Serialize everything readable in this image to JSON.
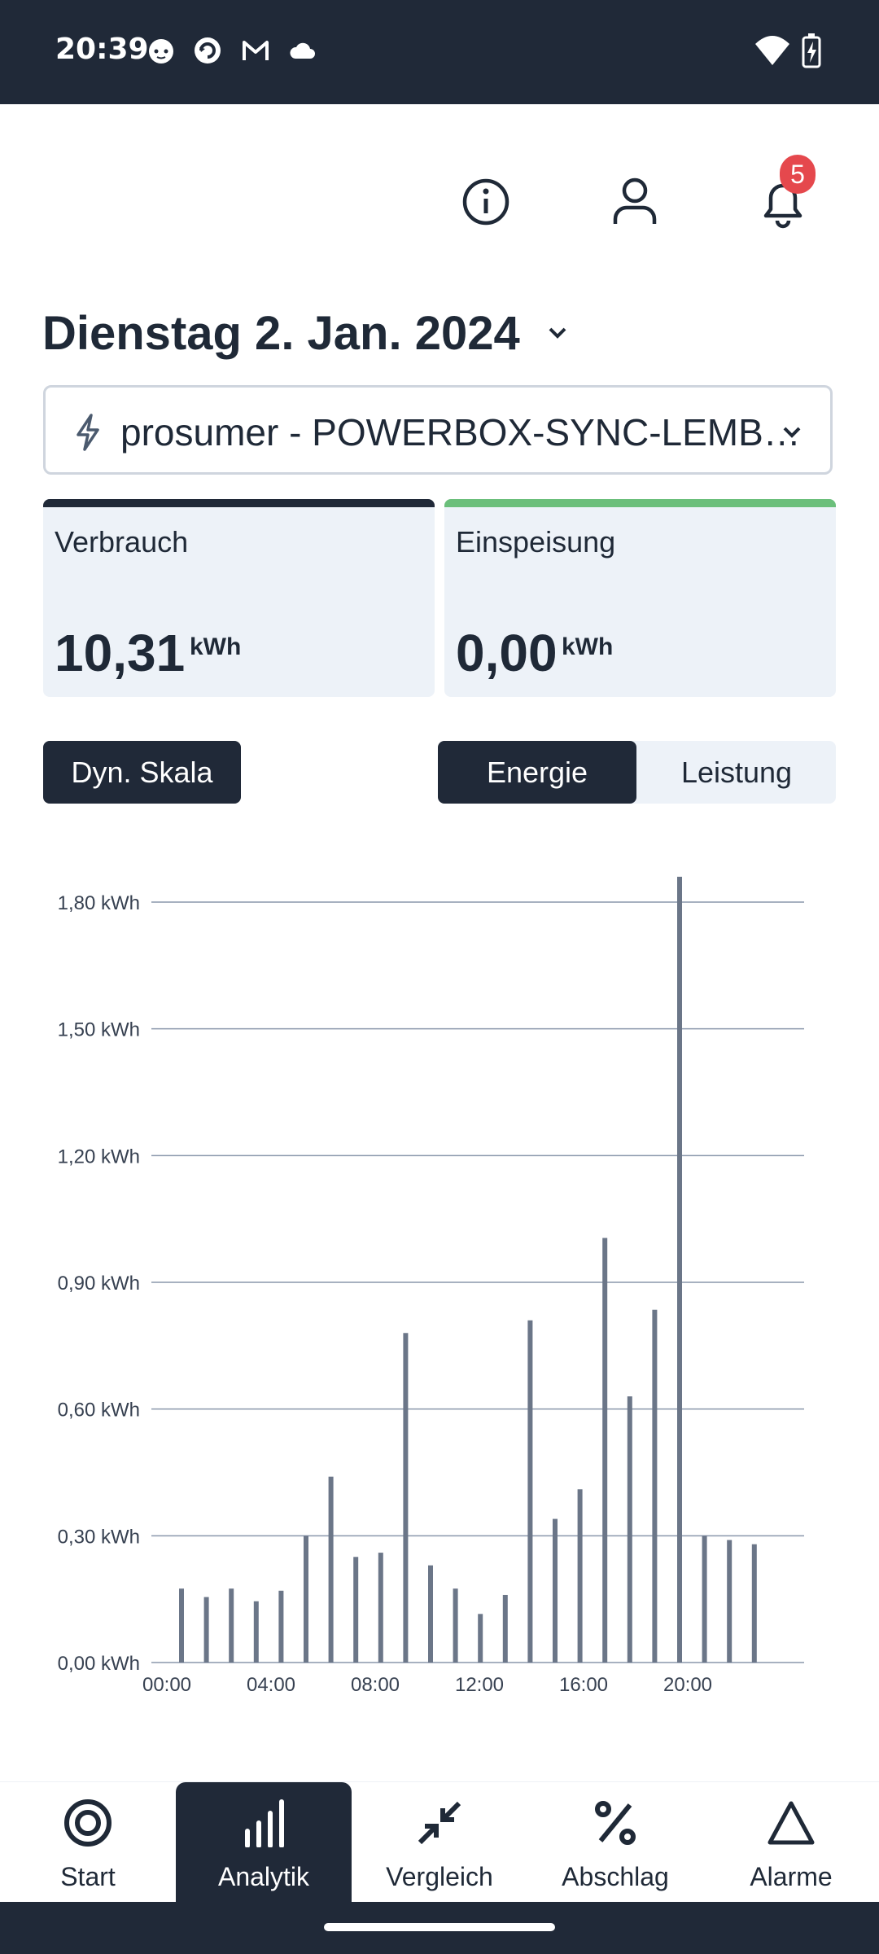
{
  "status_bar": {
    "time": "20:39"
  },
  "header": {
    "notification_count": "5"
  },
  "date": {
    "label": "Dienstag 2. Jan. 2024"
  },
  "meter_select": {
    "value": "prosumer - POWERBOX-SYNC-LEMB…"
  },
  "cards": {
    "consumption": {
      "label": "Verbrauch",
      "value": "10,31",
      "unit": "kWh",
      "color": "#202938"
    },
    "feed_in": {
      "label": "Einspeisung",
      "value": "0,00",
      "unit": "kWh",
      "color": "#6bbf7b"
    }
  },
  "controls": {
    "dyn_scale_label": "Dyn. Skala",
    "tabs": [
      {
        "label": "Energie",
        "active": true
      },
      {
        "label": "Leistung",
        "active": false
      }
    ]
  },
  "chart_data": {
    "type": "bar",
    "y_ticks": [
      "0,00 kWh",
      "0,30 kWh",
      "0,60 kWh",
      "0,90 kWh",
      "1,20 kWh",
      "1,50 kWh",
      "1,80 kWh"
    ],
    "x_ticks": [
      "00:00",
      "04:00",
      "08:00",
      "12:00",
      "16:00",
      "20:00"
    ],
    "ylim": [
      0,
      1.8
    ],
    "grid": true,
    "bar_color": "#6b7688",
    "x": [
      1,
      2,
      3,
      4,
      5,
      6,
      7,
      8,
      9,
      10,
      11,
      12,
      13,
      14,
      15,
      16,
      17,
      18,
      19,
      20,
      21,
      22,
      23,
      24
    ],
    "values": [
      0.175,
      0.155,
      0.175,
      0.145,
      0.17,
      0.3,
      0.44,
      0.25,
      0.26,
      0.78,
      0.23,
      0.175,
      0.115,
      0.16,
      0.81,
      0.34,
      0.41,
      1.005,
      0.63,
      0.835,
      1.86,
      0.3,
      0.29,
      0.28
    ]
  },
  "bottom_nav": [
    {
      "label": "Start",
      "icon": "target-icon",
      "active": false
    },
    {
      "label": "Analytik",
      "icon": "bar-chart-icon",
      "active": true
    },
    {
      "label": "Vergleich",
      "icon": "compare-arrows-icon",
      "active": false
    },
    {
      "label": "Abschlag",
      "icon": "percent-icon",
      "active": false
    },
    {
      "label": "Alarme",
      "icon": "triangle-icon",
      "active": false
    }
  ]
}
